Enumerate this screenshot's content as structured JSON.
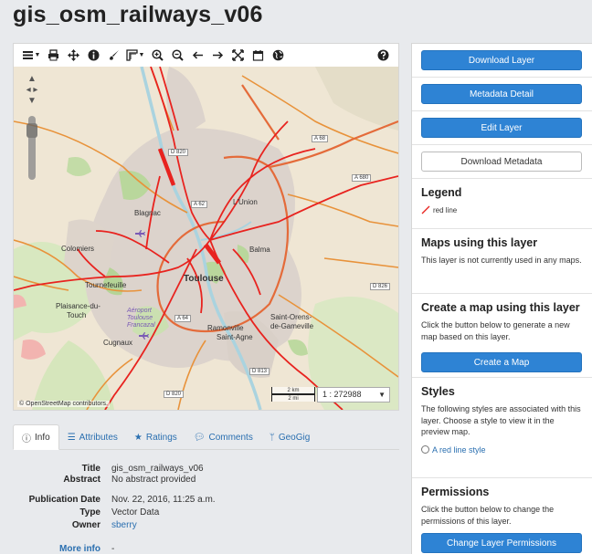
{
  "page": {
    "title": "gis_osm_railways_v06"
  },
  "toolbar": {
    "icons": [
      "menu-icon",
      "print-icon",
      "pan-icon",
      "info-icon",
      "brush-icon",
      "measure-icon",
      "zoom-in-icon",
      "zoom-out-icon",
      "back-arrow-icon",
      "forward-arrow-icon",
      "fullscreen-icon",
      "calendar-icon",
      "globe-icon",
      "help-icon"
    ]
  },
  "map": {
    "attribution": "© OpenStreetMap contributors.",
    "scale_top": "2 km",
    "scale_bottom": "2 mi",
    "scale_value": "1 : 272988",
    "labels": {
      "toulouse": "Toulouse",
      "lunion": "L'Union",
      "balma": "Balma",
      "blagnac": "Blagnac",
      "colomiers": "Colomiers",
      "tournefeuille": "Tournefeuille",
      "plaisance": "Plaisance-du-",
      "touch": "Touch",
      "cugnaux": "Cugnaux",
      "ramonville": "Ramonville",
      "saintagne": "Saint-Agne",
      "saintorens": "Saint-Orens-",
      "degameville": "de-Gameville",
      "aeroport1": "Aéroport",
      "aeroport2": "Toulouse",
      "aeroport3": "Francazal",
      "a68": "A 68",
      "a680": "A 680",
      "a62": "A 62",
      "a64": "A 64",
      "d820": "D 820",
      "d826": "D 826",
      "d813": "D 813",
      "d820b": "D 820"
    },
    "colors": {
      "railway": "#e8231f",
      "road": "#e8923a",
      "urban": "#d9d0c9",
      "green": "#c8dfae",
      "water": "#aad3df"
    }
  },
  "tabs": [
    {
      "label": "Info",
      "icon": "info-icon"
    },
    {
      "label": "Attributes",
      "icon": "list-icon"
    },
    {
      "label": "Ratings",
      "icon": "star-icon"
    },
    {
      "label": "Comments",
      "icon": "comment-icon"
    },
    {
      "label": "GeoGig",
      "icon": "branch-icon"
    }
  ],
  "info": {
    "title_label": "Title",
    "title_value": "gis_osm_railways_v06",
    "abstract_label": "Abstract",
    "abstract_value": "No abstract provided",
    "pubdate_label": "Publication Date",
    "pubdate_value": "Nov. 22, 2016, 11:25 a.m.",
    "type_label": "Type",
    "type_value": "Vector Data",
    "owner_label": "Owner",
    "owner_value": "sberry",
    "more_label": "More info",
    "more_value": "-"
  },
  "sidebar": {
    "download_layer": "Download Layer",
    "metadata_detail": "Metadata Detail",
    "edit_layer": "Edit Layer",
    "download_metadata": "Download Metadata",
    "legend_title": "Legend",
    "legend_item": "red line",
    "maps_title": "Maps using this layer",
    "maps_text": "This layer is not currently used in any maps.",
    "create_title": "Create a map using this layer",
    "create_text": "Click the button below to generate a new map based on this layer.",
    "create_button": "Create a Map",
    "styles_title": "Styles",
    "styles_text": "The following styles are associated with this layer. Choose a style to view it in the preview map.",
    "style_option": "A red line style",
    "perm_title": "Permissions",
    "perm_text": "Click the button below to change the permissions of this layer.",
    "perm_button": "Change Layer Permissions"
  }
}
